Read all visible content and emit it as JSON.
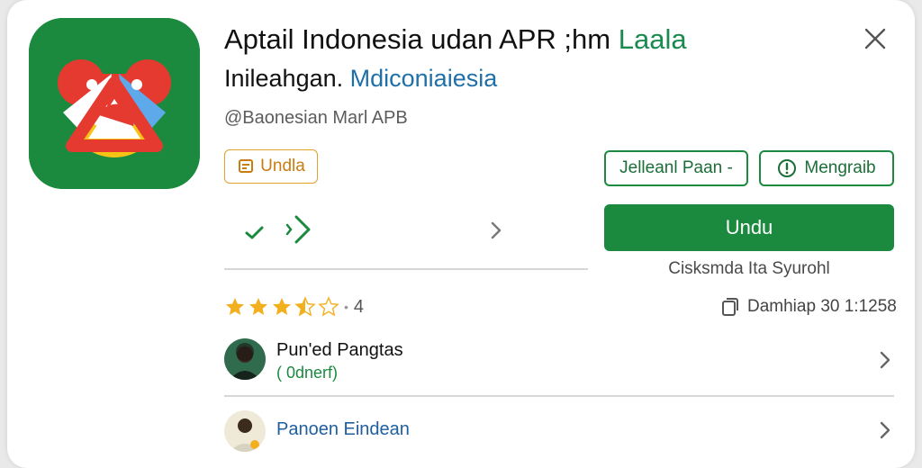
{
  "app": {
    "title_main": "Aptail Indonesia udan APR ;hm",
    "title_accent": "Laala",
    "subtitle_main": "Inileahgan.",
    "subtitle_accent": "Mdiconiaiesia",
    "developer": "@Baonesian Marl APB"
  },
  "tag": {
    "label": "Undla",
    "color": "#e3a02c"
  },
  "actions": {
    "left_button": "Jelleanl Paan -",
    "right_button": "Mengraib",
    "primary_button": "Undu",
    "install_note": "Cisksmda Ita Syurohl"
  },
  "rating": {
    "stars_filled": 3,
    "stars_half": 1,
    "stars_total": 5,
    "count": "4"
  },
  "downloads": {
    "label": "Damhiap 30 1:1258"
  },
  "reviews": [
    {
      "name": "Pun'ed Pangtas",
      "sub": "( 0dnerf)"
    },
    {
      "name": "Panoen Eindean",
      "sub": ""
    }
  ],
  "colors": {
    "accent_green": "#1b8a3f",
    "star": "#f2b01e",
    "tag_orange": "#e3a02c",
    "link_blue": "#1f6fa8"
  },
  "icons": [
    "app-logo-icon",
    "close-icon",
    "tag-icon",
    "check-icon",
    "chevron-right-icon",
    "info-icon",
    "star-icon",
    "copy-icon"
  ]
}
